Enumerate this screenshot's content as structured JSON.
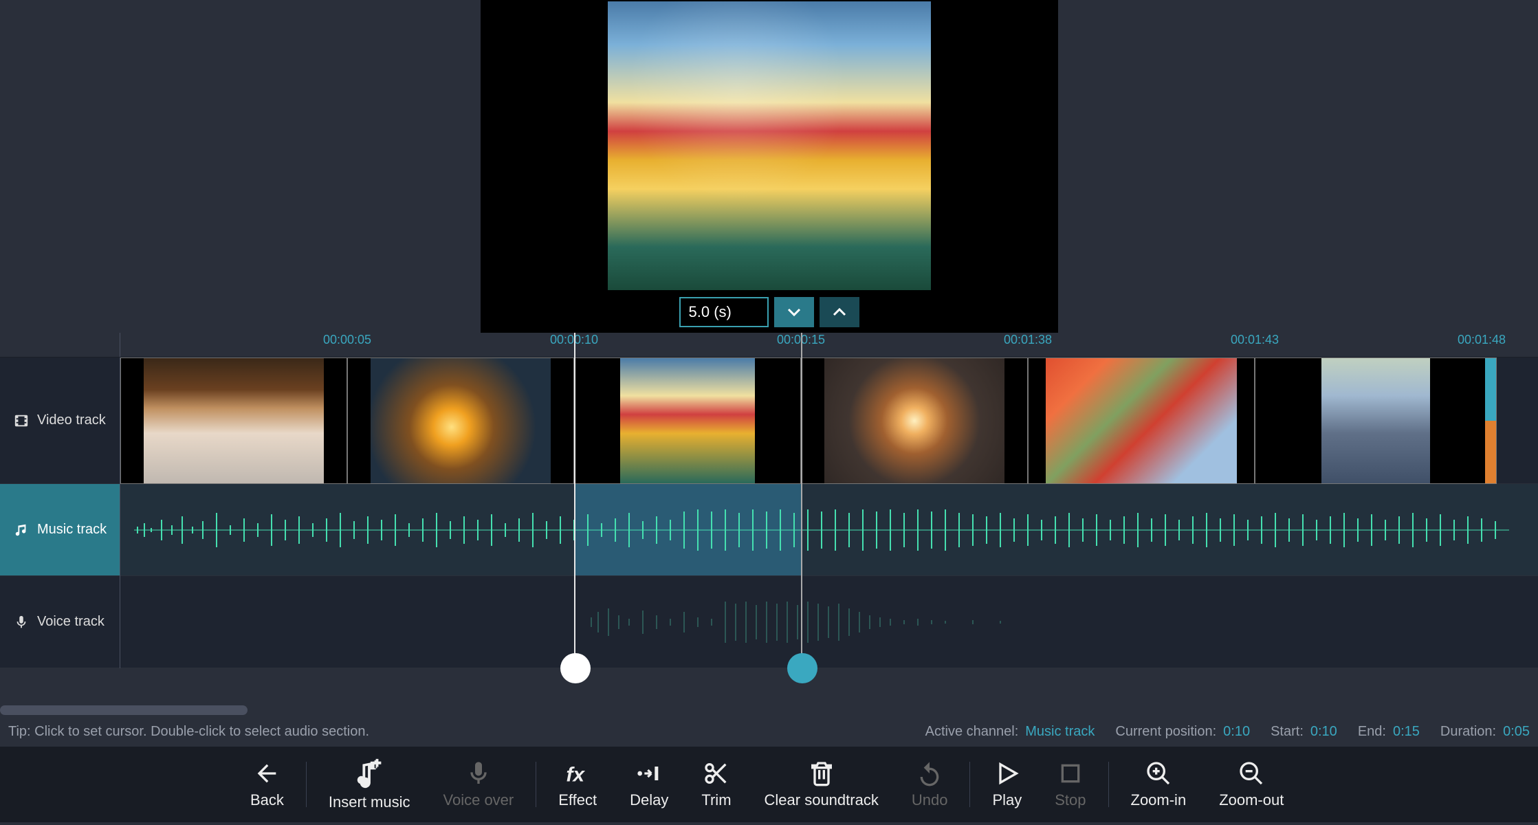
{
  "preview": {
    "duration_value": "5.0 (s)"
  },
  "ruler": {
    "marks": [
      "00:00:05",
      "00:00:10",
      "00:00:15",
      "00:01:38",
      "00:01:43",
      "00:01:48"
    ]
  },
  "tracks": {
    "video_label": "Video track",
    "music_label": "Music track",
    "voice_label": "Voice track"
  },
  "status": {
    "tip": "Tip: Click to set cursor. Double-click to select audio section.",
    "active_channel_label": "Active channel:",
    "active_channel_value": "Music track",
    "current_pos_label": "Current position:",
    "current_pos_value": "0:10",
    "start_label": "Start:",
    "start_value": "0:10",
    "end_label": "End:",
    "end_value": "0:15",
    "duration_label": "Duration:",
    "duration_value": "0:05"
  },
  "toolbar": {
    "back": "Back",
    "insert_music": "Insert music",
    "voice_over": "Voice over",
    "effect": "Effect",
    "delay": "Delay",
    "trim": "Trim",
    "clear_soundtrack": "Clear soundtrack",
    "undo": "Undo",
    "play": "Play",
    "stop": "Stop",
    "zoom_in": "Zoom-in",
    "zoom_out": "Zoom-out"
  }
}
